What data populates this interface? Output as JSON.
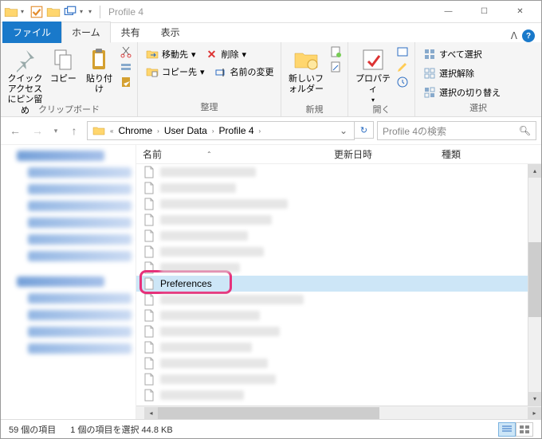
{
  "window": {
    "title": "Profile 4"
  },
  "tabs": {
    "file": "ファイル",
    "home": "ホーム",
    "share": "共有",
    "view": "表示"
  },
  "ribbon": {
    "clipboard": {
      "label": "クリップボード",
      "pin": "クイック アクセスにピン留め",
      "copy": "コピー",
      "paste": "貼り付け"
    },
    "organize": {
      "label": "整理",
      "moveTo": "移動先",
      "copyTo": "コピー先",
      "delete": "削除",
      "rename": "名前の変更"
    },
    "new": {
      "label": "新規",
      "newFolder": "新しいフォルダー"
    },
    "open": {
      "label": "開く",
      "properties": "プロパティ"
    },
    "select": {
      "label": "選択",
      "selectAll": "すべて選択",
      "selectNone": "選択解除",
      "invert": "選択の切り替え"
    }
  },
  "breadcrumb": [
    "Chrome",
    "User Data",
    "Profile 4"
  ],
  "search": {
    "placeholder": "Profile 4の検索"
  },
  "columns": {
    "name": "名前",
    "date": "更新日時",
    "type": "種類"
  },
  "files": {
    "highlighted": "Preferences"
  },
  "statusbar": {
    "items": "59 個の項目",
    "selected": "1 個の項目を選択 44.8 KB"
  }
}
